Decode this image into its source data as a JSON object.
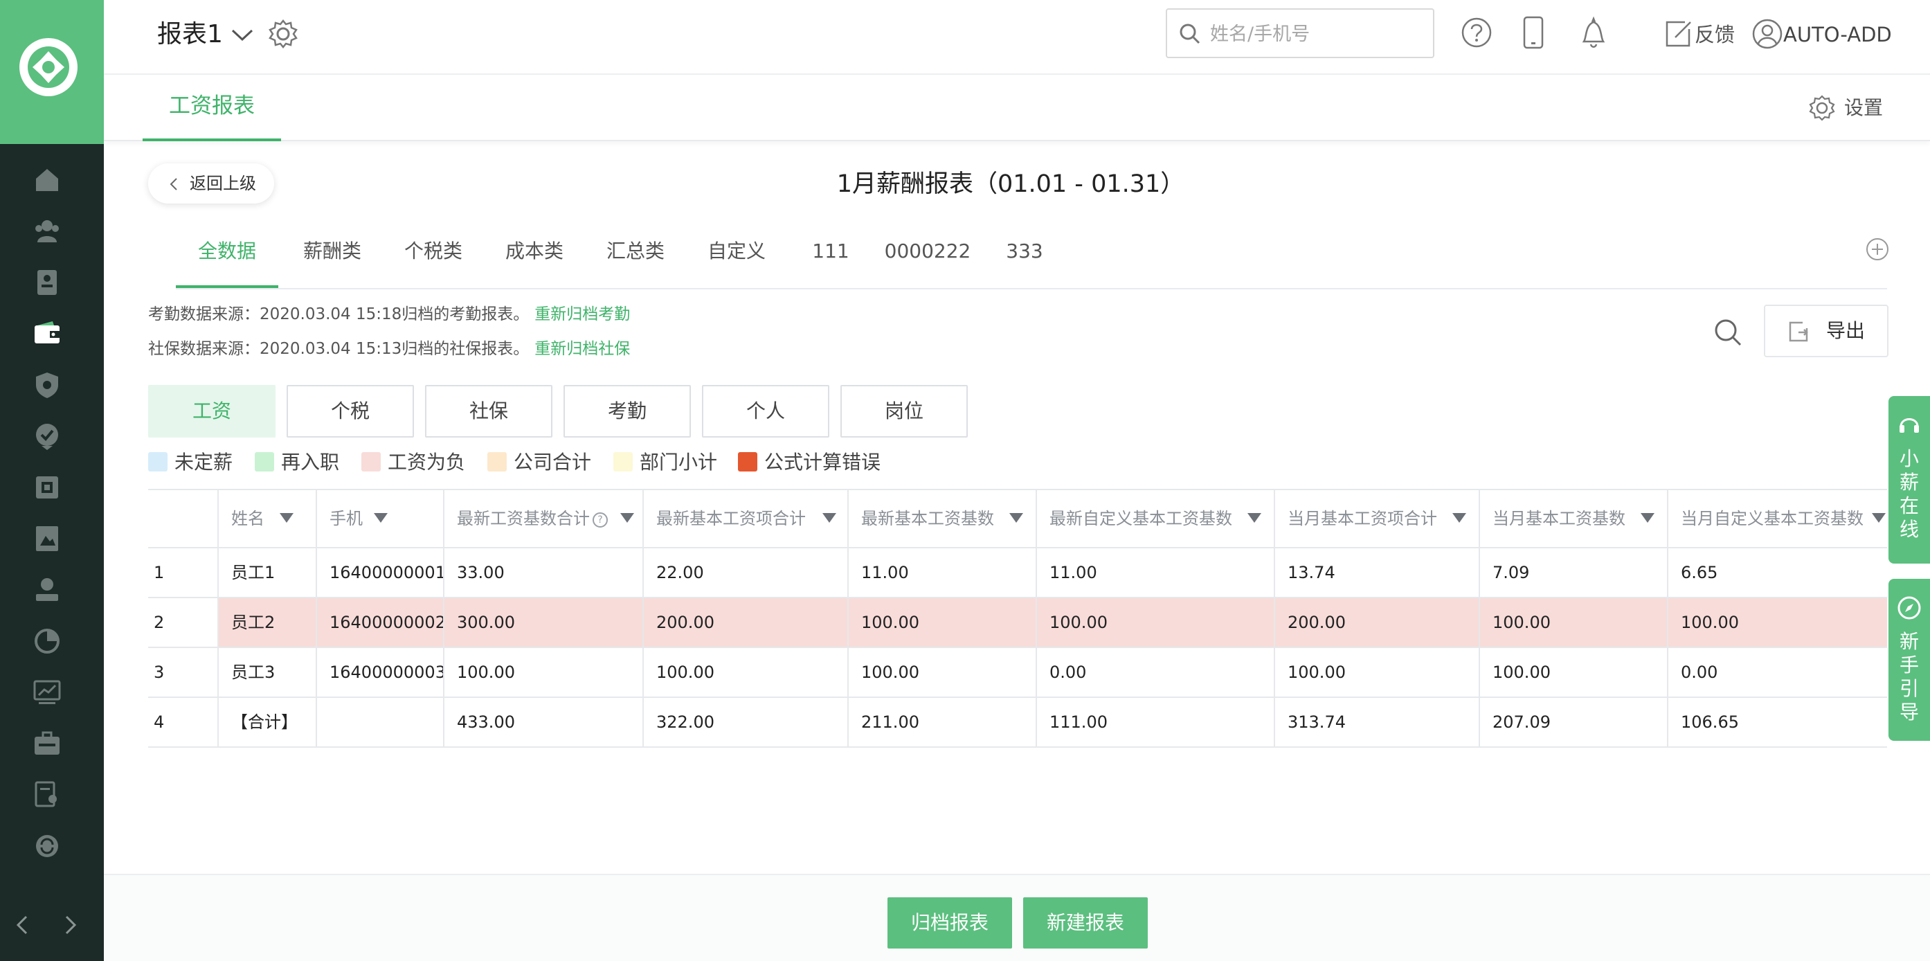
{
  "header": {
    "report_name": "报表1",
    "search_placeholder": "姓名/手机号",
    "feedback": "反馈",
    "user": "AUTO-ADD"
  },
  "nav": {
    "active_tab": "工资报表",
    "settings": "设置"
  },
  "page": {
    "back": "返回上级",
    "title": "1月薪酬报表（01.01 - 01.31）"
  },
  "category_tabs": [
    "全数据",
    "薪酬类",
    "个税类",
    "成本类",
    "汇总类",
    "自定义",
    "111",
    "0000222",
    "333"
  ],
  "sources": {
    "attendance_label": "考勤数据来源：2020.03.04 15:18归档的考勤报表。",
    "attendance_link": "重新归档考勤",
    "social_label": "社保数据来源：2020.03.04 15:13归档的社保报表。",
    "social_link": "重新归档社保"
  },
  "export": "导出",
  "filters": [
    "工资",
    "个税",
    "社保",
    "考勤",
    "个人",
    "岗位"
  ],
  "legend": [
    {
      "label": "未定薪",
      "color": "#d6ecfa"
    },
    {
      "label": "再入职",
      "color": "#c9f2d2"
    },
    {
      "label": "工资为负",
      "color": "#f8dcd9"
    },
    {
      "label": "公司合计",
      "color": "#fde8cc"
    },
    {
      "label": "部门小计",
      "color": "#fdf8d6"
    },
    {
      "label": "公式计算错误",
      "color": "#e4572e"
    }
  ],
  "table": {
    "headers": [
      "姓名",
      "手机",
      "最新工资基数合计",
      "最新基本工资项合计",
      "最新基本工资基数",
      "最新自定义基本工资基数",
      "当月基本工资项合计",
      "当月基本工资基数",
      "当月自定义基本工资基数"
    ],
    "rows": [
      [
        "1",
        "员工1",
        "16400000001",
        "33.00",
        "22.00",
        "11.00",
        "11.00",
        "13.74",
        "7.09",
        "6.65"
      ],
      [
        "2",
        "员工2",
        "16400000002",
        "300.00",
        "200.00",
        "100.00",
        "100.00",
        "200.00",
        "100.00",
        "100.00"
      ],
      [
        "3",
        "员工3",
        "16400000003",
        "100.00",
        "100.00",
        "100.00",
        "0.00",
        "100.00",
        "100.00",
        "0.00"
      ],
      [
        "4",
        "【合计】",
        "",
        "433.00",
        "322.00",
        "211.00",
        "111.00",
        "313.74",
        "207.09",
        "106.65"
      ]
    ]
  },
  "float": {
    "service": "小薪在线",
    "guide": "新手引导"
  },
  "actions": {
    "archive": "归档报表",
    "new": "新建报表"
  },
  "colors": {
    "brand": "#5bbf7f",
    "accent": "#3fb36a",
    "sidebar": "#1c2a28",
    "negative_row": "#f8dcd9"
  }
}
